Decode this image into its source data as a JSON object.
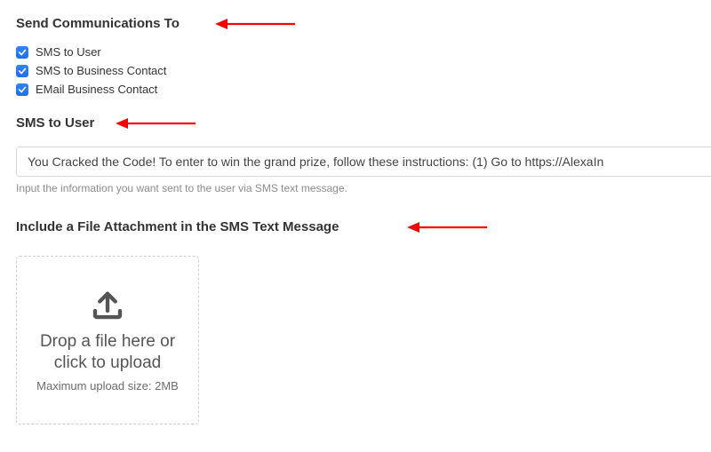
{
  "sections": {
    "send_to": {
      "title": "Send Communications To",
      "options": [
        {
          "label": "SMS to User",
          "checked": true
        },
        {
          "label": "SMS to Business Contact",
          "checked": true
        },
        {
          "label": "EMail Business Contact",
          "checked": true
        }
      ]
    },
    "sms_to_user": {
      "title": "SMS to User",
      "input_value": "You Cracked the Code! To enter to win the grand prize, follow these instructions: (1) Go to https://AlexaIn",
      "helper": "Input the information you want sent to the user via SMS text message."
    },
    "attachment": {
      "title": "Include a File Attachment in the SMS Text Message",
      "upload_text": "Drop a file here or click to upload",
      "upload_sub": "Maximum upload size: 2MB"
    }
  }
}
